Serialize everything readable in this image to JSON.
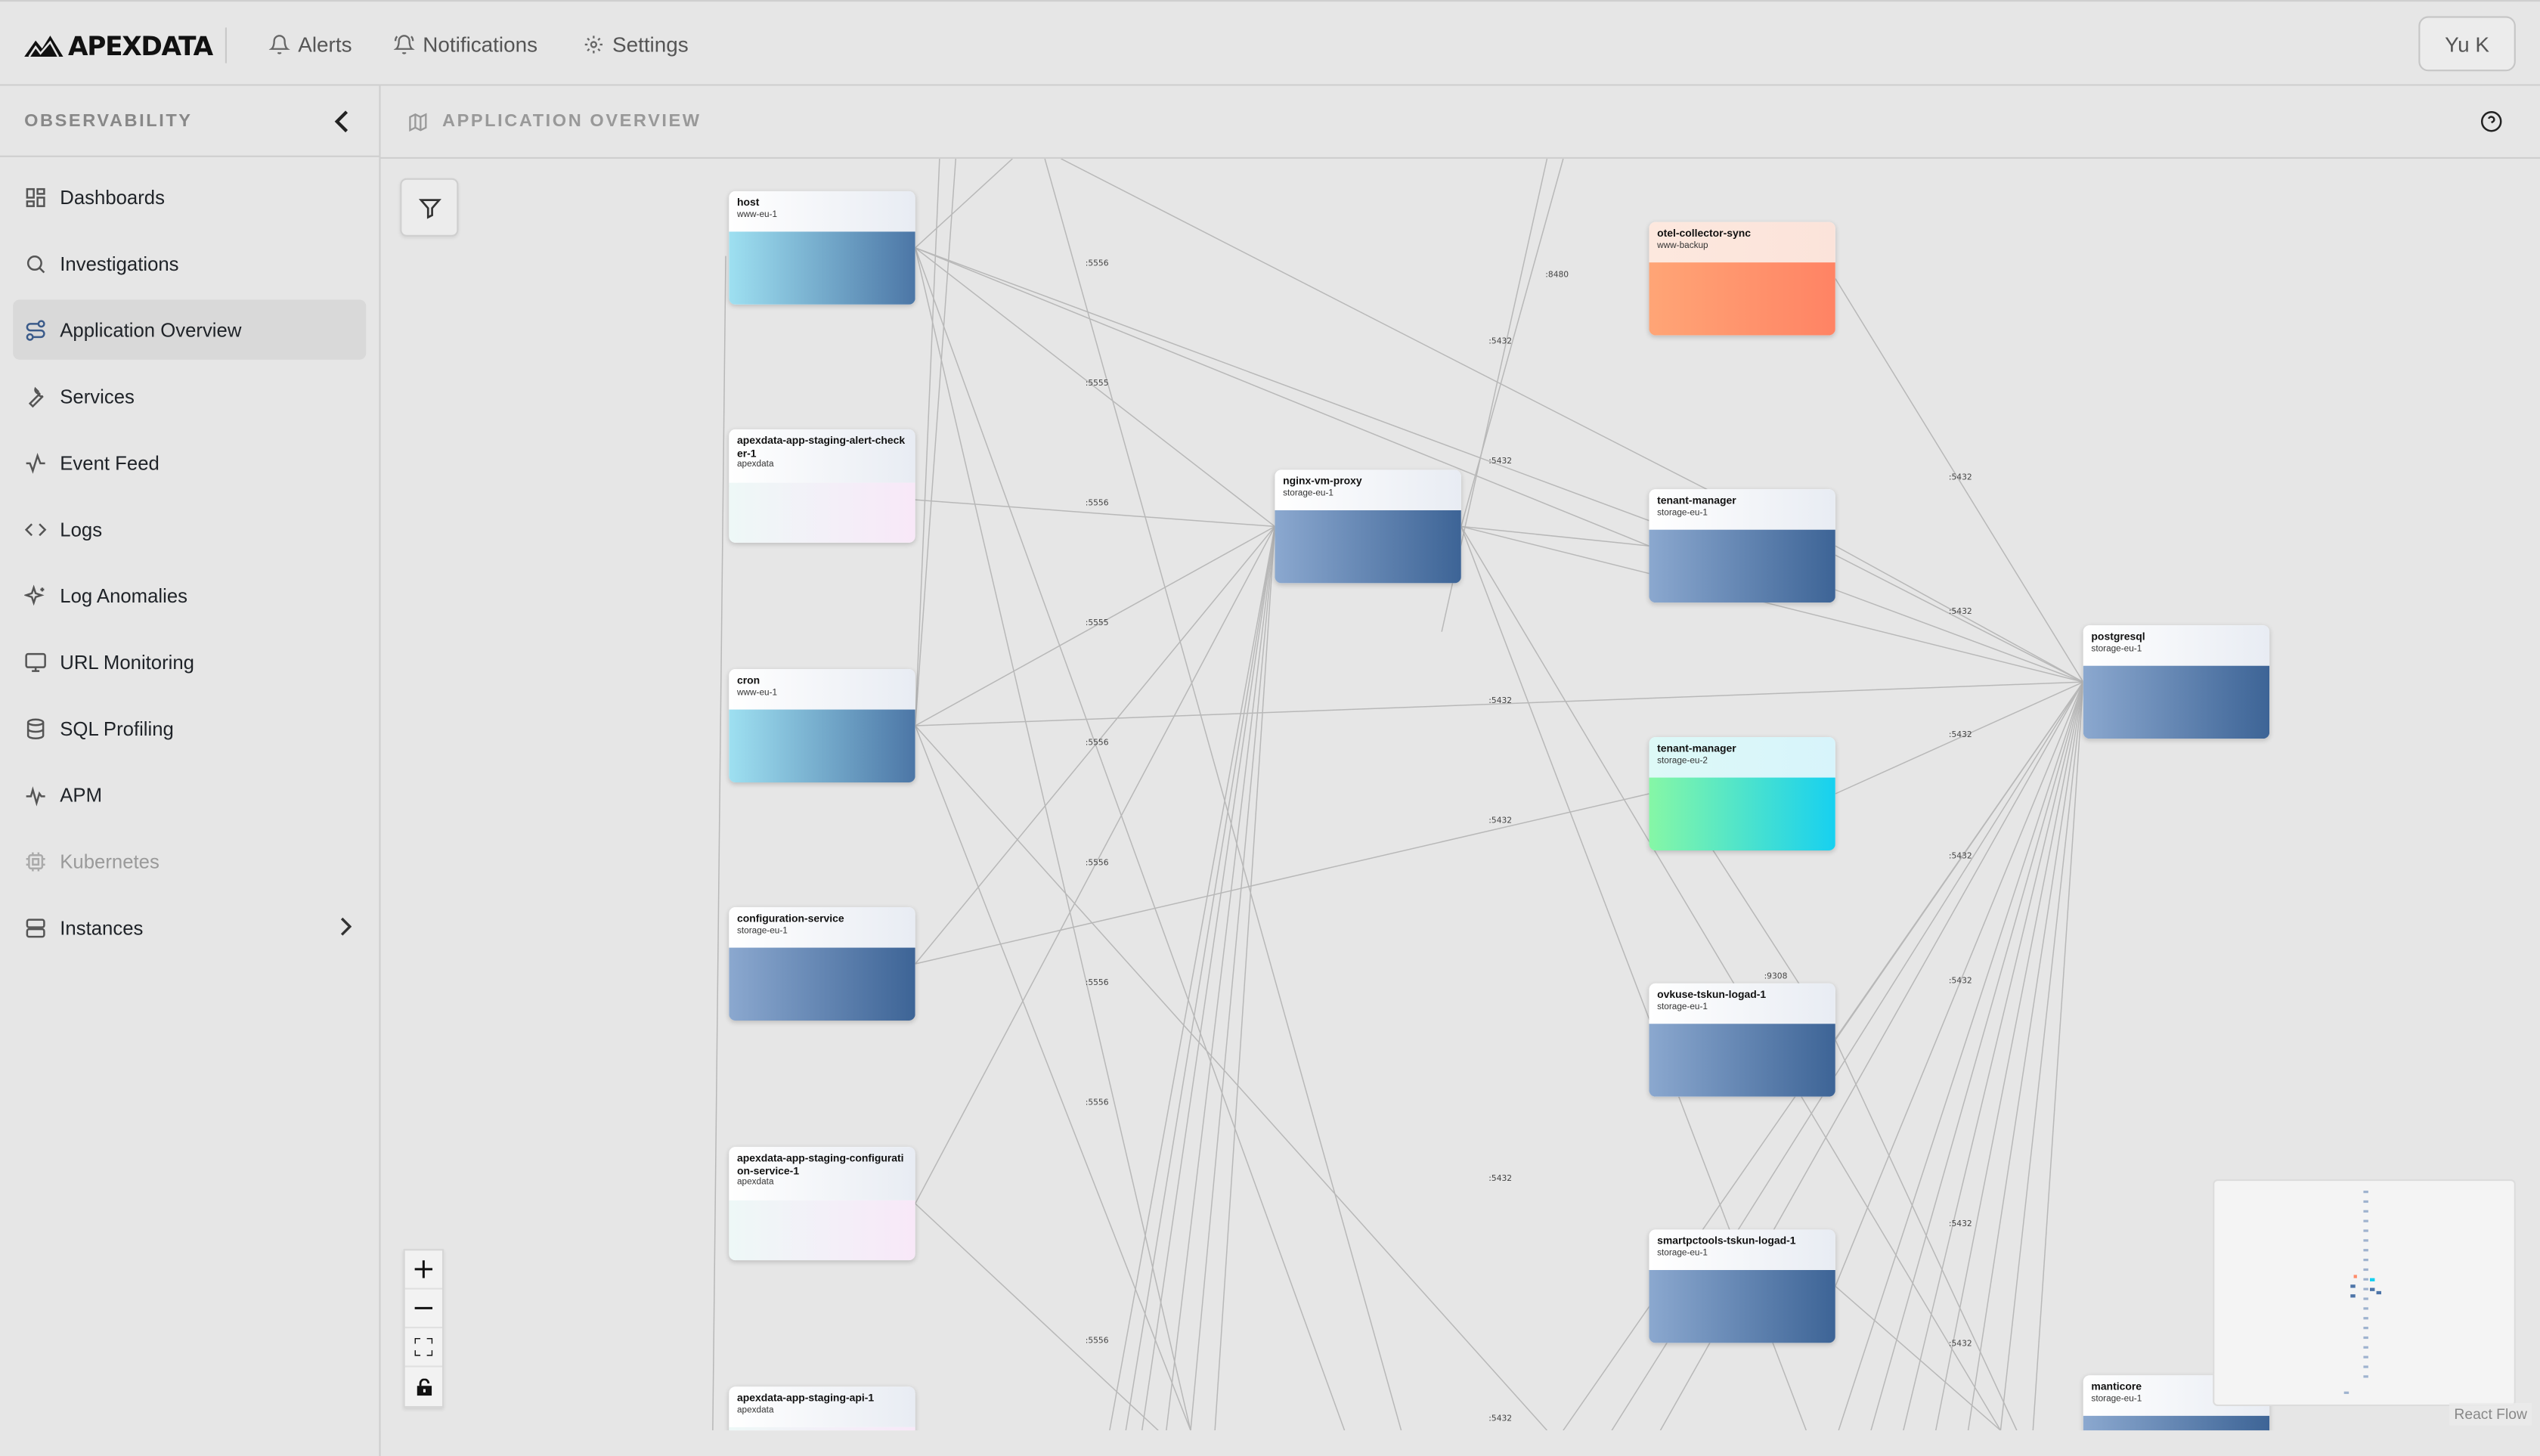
{
  "app": {
    "logo": "APEXDATA"
  },
  "topnav": [
    {
      "label": "Alerts",
      "icon": "bell-icon"
    },
    {
      "label": "Notifications",
      "icon": "bell-ring-icon"
    },
    {
      "label": "Settings",
      "icon": "gear-icon"
    }
  ],
  "user": {
    "label": "Yu K"
  },
  "sidebar": {
    "title": "OBSERVABILITY",
    "items": [
      {
        "label": "Dashboards",
        "icon": "grid-icon"
      },
      {
        "label": "Investigations",
        "icon": "search-icon"
      },
      {
        "label": "Application Overview",
        "icon": "route-icon",
        "active": true
      },
      {
        "label": "Services",
        "icon": "wrench-icon"
      },
      {
        "label": "Event Feed",
        "icon": "activity-icon"
      },
      {
        "label": "Logs",
        "icon": "code-icon"
      },
      {
        "label": "Log Anomalies",
        "icon": "sparkles-icon"
      },
      {
        "label": "URL Monitoring",
        "icon": "monitor-icon"
      },
      {
        "label": "SQL Profiling",
        "icon": "database-icon"
      },
      {
        "label": "APM",
        "icon": "pulse-icon"
      },
      {
        "label": "Kubernetes",
        "icon": "cpu-icon",
        "disabled": true
      },
      {
        "label": "Instances",
        "icon": "server-icon",
        "expandable": true
      }
    ]
  },
  "main": {
    "title": "APPLICATION OVERVIEW"
  },
  "graph": {
    "nodes": [
      {
        "id": "host",
        "name": "host",
        "sub": "www-eu-1",
        "style": "cyan"
      },
      {
        "id": "alert",
        "name": "apexdata-app-staging-alert-check er-1",
        "sub": "apexdata",
        "style": "white"
      },
      {
        "id": "cron",
        "name": "cron",
        "sub": "www-eu-1",
        "style": "cyan"
      },
      {
        "id": "config",
        "name": "configuration-service",
        "sub": "storage-eu-1",
        "style": "blue"
      },
      {
        "id": "confsvc",
        "name": "apexdata-app-staging-configurati on-service-1",
        "sub": "apexdata",
        "style": "white"
      },
      {
        "id": "api",
        "name": "apexdata-app-staging-api-1",
        "sub": "apexdata",
        "style": "white"
      },
      {
        "id": "nginx",
        "name": "nginx-vm-proxy",
        "sub": "storage-eu-1",
        "style": "blue"
      },
      {
        "id": "otel",
        "name": "otel-collector-sync",
        "sub": "www-backup",
        "style": "orange"
      },
      {
        "id": "tm1",
        "name": "tenant-manager",
        "sub": "storage-eu-1",
        "style": "blue"
      },
      {
        "id": "tm2",
        "name": "tenant-manager",
        "sub": "storage-eu-2",
        "style": "green"
      },
      {
        "id": "ovk",
        "name": "ovkuse-tskun-logad-1",
        "sub": "storage-eu-1",
        "style": "blue"
      },
      {
        "id": "smart",
        "name": "smartpctools-tskun-logad-1",
        "sub": "storage-eu-1",
        "style": "blue"
      },
      {
        "id": "pg",
        "name": "postgresql",
        "sub": "storage-eu-1",
        "style": "blue"
      },
      {
        "id": "manti",
        "name": "manticore",
        "sub": "storage-eu-1",
        "style": "blue"
      }
    ],
    "edge_labels": [
      ":5556",
      ":5555",
      ":5556",
      ":5555",
      ":5556",
      ":5556",
      ":5556",
      ":5556",
      ":5556",
      ":5432",
      ":5432",
      ":5432",
      ":5432",
      ":5432",
      ":5432",
      ":8480",
      ":5432",
      ":5432",
      ":5432",
      ":5432",
      ":5432",
      ":5432",
      ":5432",
      ":9308"
    ]
  },
  "flow": {
    "attribution": "React Flow"
  }
}
